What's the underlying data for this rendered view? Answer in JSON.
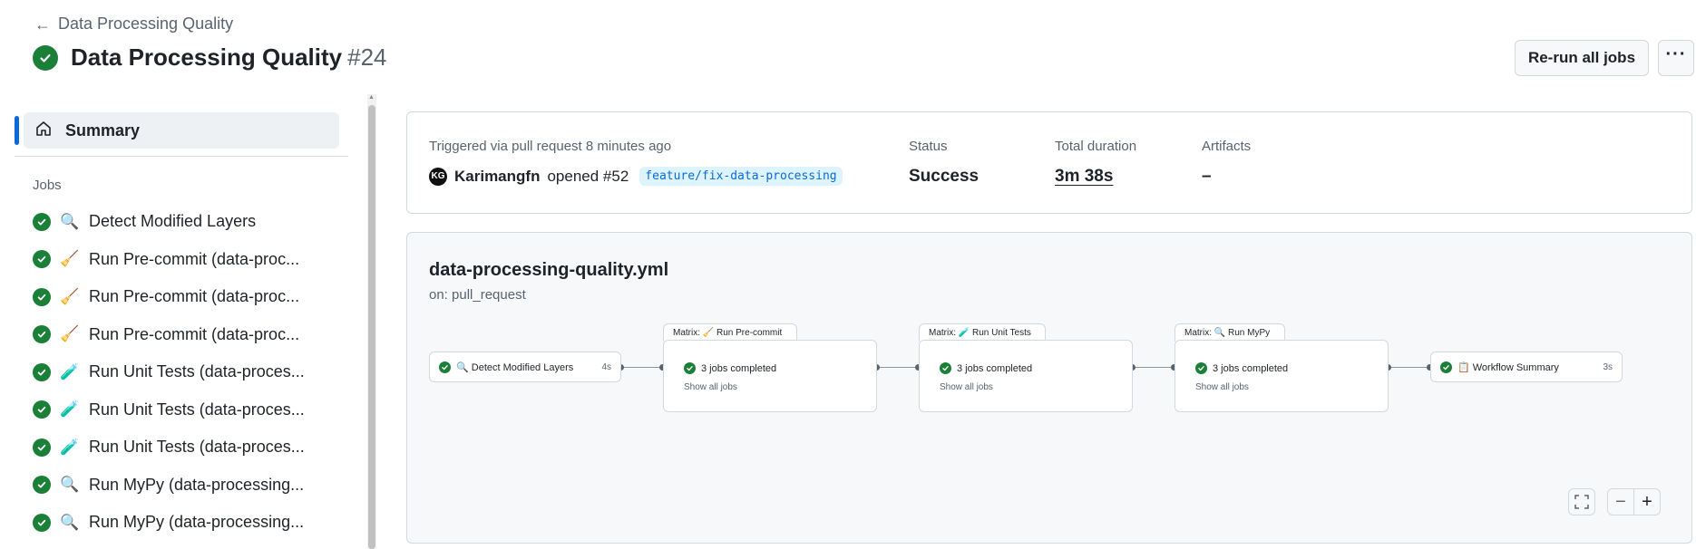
{
  "header": {
    "back_label": "Data Processing Quality",
    "title": "Data Processing Quality",
    "run_number": "#24",
    "rerun_label": "Re-run all jobs",
    "more_label": "···"
  },
  "sidebar": {
    "summary_label": "Summary",
    "jobs_heading": "Jobs",
    "jobs": [
      {
        "emoji": "🔍",
        "label": "Detect Modified Layers"
      },
      {
        "emoji": "🧹",
        "label": "Run Pre-commit (data-proc..."
      },
      {
        "emoji": "🧹",
        "label": "Run Pre-commit (data-proc..."
      },
      {
        "emoji": "🧹",
        "label": "Run Pre-commit (data-proc..."
      },
      {
        "emoji": "🧪",
        "label": "Run Unit Tests (data-proces..."
      },
      {
        "emoji": "🧪",
        "label": "Run Unit Tests (data-proces..."
      },
      {
        "emoji": "🧪",
        "label": "Run Unit Tests (data-proces..."
      },
      {
        "emoji": "🔍",
        "label": "Run MyPy (data-processing..."
      },
      {
        "emoji": "🔍",
        "label": "Run MyPy (data-processing..."
      }
    ]
  },
  "summary": {
    "trigger_label": "Triggered via pull request 8 minutes ago",
    "avatar_initials": "KG",
    "actor": "Karimangfn",
    "action": "opened #52",
    "branch": "feature/fix-data-processing",
    "status_label": "Status",
    "status_value": "Success",
    "duration_label": "Total duration",
    "duration_value": "3m 38s",
    "artifacts_label": "Artifacts",
    "artifacts_value": "–"
  },
  "workflow": {
    "file": "data-processing-quality.yml",
    "trigger": "on: pull_request",
    "nodes": {
      "detect": {
        "label": "🔍 Detect Modified Layers",
        "duration": "4s"
      },
      "precommit": {
        "tab": "Matrix: 🧹 Run Pre-commit",
        "status": "3 jobs completed",
        "link": "Show all jobs"
      },
      "unittests": {
        "tab": "Matrix: 🧪 Run Unit Tests",
        "status": "3 jobs completed",
        "link": "Show all jobs"
      },
      "mypy": {
        "tab": "Matrix: 🔍 Run MyPy",
        "status": "3 jobs completed",
        "link": "Show all jobs"
      },
      "summary": {
        "label": "📋 Workflow Summary",
        "duration": "3s"
      }
    },
    "zoom_out_label": "−",
    "zoom_in_label": "+",
    "fullscreen_label": "⛶"
  },
  "colors": {
    "success": "#1a7f37",
    "accent": "#0969da"
  }
}
